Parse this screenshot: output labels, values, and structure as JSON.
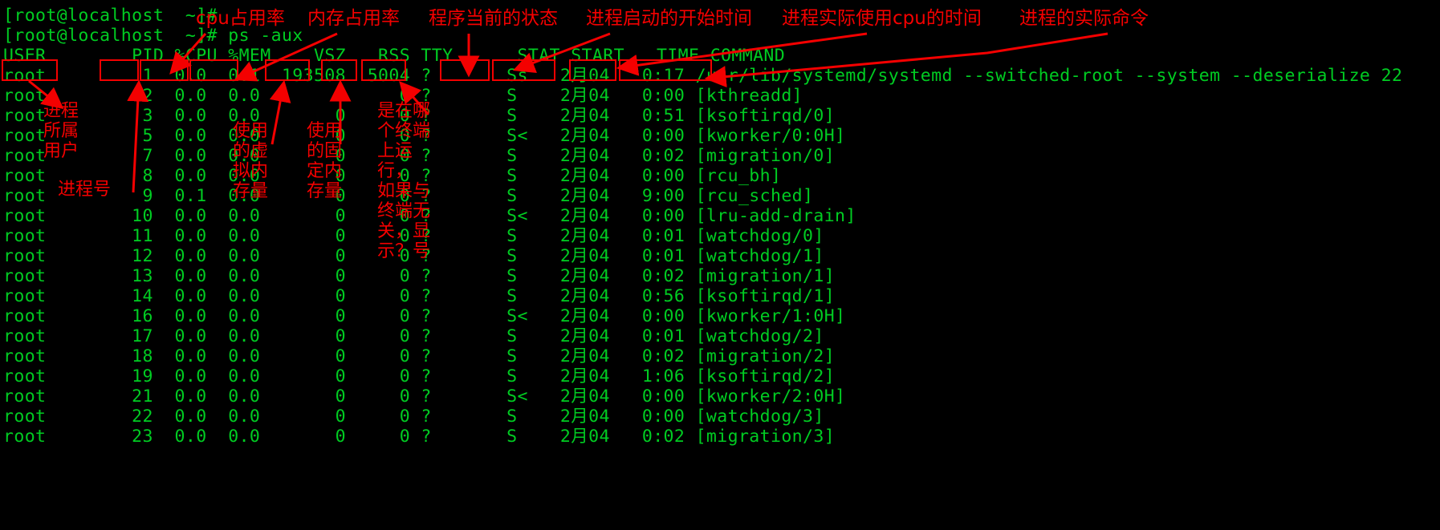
{
  "terminal": {
    "prompt_line_1": "[root@localhost  ~]#",
    "prompt_line_2": "[root@localhost  ~]# ps -aux",
    "command": "ps -aux",
    "foreground_color": "#00cc22",
    "background_color": "#000000",
    "annotation_color": "#f40000",
    "columns": [
      "USER",
      "PID",
      "%CPU",
      "%MEM",
      "VSZ",
      "RSS",
      "TTY",
      "STAT",
      "START",
      "TIME",
      "COMMAND"
    ],
    "header_line": "USER        PID %CPU %MEM    VSZ   RSS TTY      STAT START   TIME COMMAND",
    "rows": [
      {
        "user": "root",
        "pid": "1",
        "cpu": "0.0",
        "mem": "0.1",
        "vsz": "193508",
        "rss": "5004",
        "tty": "?",
        "stat": "Ss",
        "start": "2月04",
        "time": "0:17",
        "command": "/usr/lib/systemd/systemd --switched-root --system --deserialize 22"
      },
      {
        "user": "root",
        "pid": "2",
        "cpu": "0.0",
        "mem": "0.0",
        "vsz": "0",
        "rss": "0",
        "tty": "?",
        "stat": "S",
        "start": "2月04",
        "time": "0:00",
        "command": "[kthreadd]"
      },
      {
        "user": "root",
        "pid": "3",
        "cpu": "0.0",
        "mem": "0.0",
        "vsz": "0",
        "rss": "0",
        "tty": "?",
        "stat": "S",
        "start": "2月04",
        "time": "0:51",
        "command": "[ksoftirqd/0]"
      },
      {
        "user": "root",
        "pid": "5",
        "cpu": "0.0",
        "mem": "0.0",
        "vsz": "0",
        "rss": "0",
        "tty": "?",
        "stat": "S<",
        "start": "2月04",
        "time": "0:00",
        "command": "[kworker/0:0H]"
      },
      {
        "user": "root",
        "pid": "7",
        "cpu": "0.0",
        "mem": "0.0",
        "vsz": "0",
        "rss": "0",
        "tty": "?",
        "stat": "S",
        "start": "2月04",
        "time": "0:02",
        "command": "[migration/0]"
      },
      {
        "user": "root",
        "pid": "8",
        "cpu": "0.0",
        "mem": "0.0",
        "vsz": "0",
        "rss": "0",
        "tty": "?",
        "stat": "S",
        "start": "2月04",
        "time": "0:00",
        "command": "[rcu_bh]"
      },
      {
        "user": "root",
        "pid": "9",
        "cpu": "0.1",
        "mem": "0.0",
        "vsz": "0",
        "rss": "0",
        "tty": "?",
        "stat": "S",
        "start": "2月04",
        "time": "9:00",
        "command": "[rcu_sched]"
      },
      {
        "user": "root",
        "pid": "10",
        "cpu": "0.0",
        "mem": "0.0",
        "vsz": "0",
        "rss": "0",
        "tty": "?",
        "stat": "S<",
        "start": "2月04",
        "time": "0:00",
        "command": "[lru-add-drain]"
      },
      {
        "user": "root",
        "pid": "11",
        "cpu": "0.0",
        "mem": "0.0",
        "vsz": "0",
        "rss": "0",
        "tty": "?",
        "stat": "S",
        "start": "2月04",
        "time": "0:01",
        "command": "[watchdog/0]"
      },
      {
        "user": "root",
        "pid": "12",
        "cpu": "0.0",
        "mem": "0.0",
        "vsz": "0",
        "rss": "0",
        "tty": "?",
        "stat": "S",
        "start": "2月04",
        "time": "0:01",
        "command": "[watchdog/1]"
      },
      {
        "user": "root",
        "pid": "13",
        "cpu": "0.0",
        "mem": "0.0",
        "vsz": "0",
        "rss": "0",
        "tty": "?",
        "stat": "S",
        "start": "2月04",
        "time": "0:02",
        "command": "[migration/1]"
      },
      {
        "user": "root",
        "pid": "14",
        "cpu": "0.0",
        "mem": "0.0",
        "vsz": "0",
        "rss": "0",
        "tty": "?",
        "stat": "S",
        "start": "2月04",
        "time": "0:56",
        "command": "[ksoftirqd/1]"
      },
      {
        "user": "root",
        "pid": "16",
        "cpu": "0.0",
        "mem": "0.0",
        "vsz": "0",
        "rss": "0",
        "tty": "?",
        "stat": "S<",
        "start": "2月04",
        "time": "0:00",
        "command": "[kworker/1:0H]"
      },
      {
        "user": "root",
        "pid": "17",
        "cpu": "0.0",
        "mem": "0.0",
        "vsz": "0",
        "rss": "0",
        "tty": "?",
        "stat": "S",
        "start": "2月04",
        "time": "0:01",
        "command": "[watchdog/2]"
      },
      {
        "user": "root",
        "pid": "18",
        "cpu": "0.0",
        "mem": "0.0",
        "vsz": "0",
        "rss": "0",
        "tty": "?",
        "stat": "S",
        "start": "2月04",
        "time": "0:02",
        "command": "[migration/2]"
      },
      {
        "user": "root",
        "pid": "19",
        "cpu": "0.0",
        "mem": "0.0",
        "vsz": "0",
        "rss": "0",
        "tty": "?",
        "stat": "S",
        "start": "2月04",
        "time": "1:06",
        "command": "[ksoftirqd/2]"
      },
      {
        "user": "root",
        "pid": "21",
        "cpu": "0.0",
        "mem": "0.0",
        "vsz": "0",
        "rss": "0",
        "tty": "?",
        "stat": "S<",
        "start": "2月04",
        "time": "0:00",
        "command": "[kworker/2:0H]"
      },
      {
        "user": "root",
        "pid": "22",
        "cpu": "0.0",
        "mem": "0.0",
        "vsz": "0",
        "rss": "0",
        "tty": "?",
        "stat": "S",
        "start": "2月04",
        "time": "0:00",
        "command": "[watchdog/3]"
      },
      {
        "user": "root",
        "pid": "23",
        "cpu": "0.0",
        "mem": "0.0",
        "vsz": "0",
        "rss": "0",
        "tty": "?",
        "stat": "S",
        "start": "2月04",
        "time": "0:02",
        "command": "[migration/3]"
      }
    ]
  },
  "annotations": {
    "cpu_label": "cpu占用率",
    "mem_label": "内存占用率",
    "stat_label": "程序当前的状态",
    "start_label": "进程启动的开始时间",
    "time_label": "进程实际使用cpu的时间",
    "command_label": "进程的实际命令",
    "user_label": "进程\n所属\n用户",
    "pid_label": "进程号",
    "vsz_label": "使用\n的虚\n拟内\n存量",
    "rss_label": "使用\n的固\n定内\n存量",
    "tty_label": "是在哪\n个终端\n上运行，\n如果与\n终端无\n关，显\n示？号"
  }
}
